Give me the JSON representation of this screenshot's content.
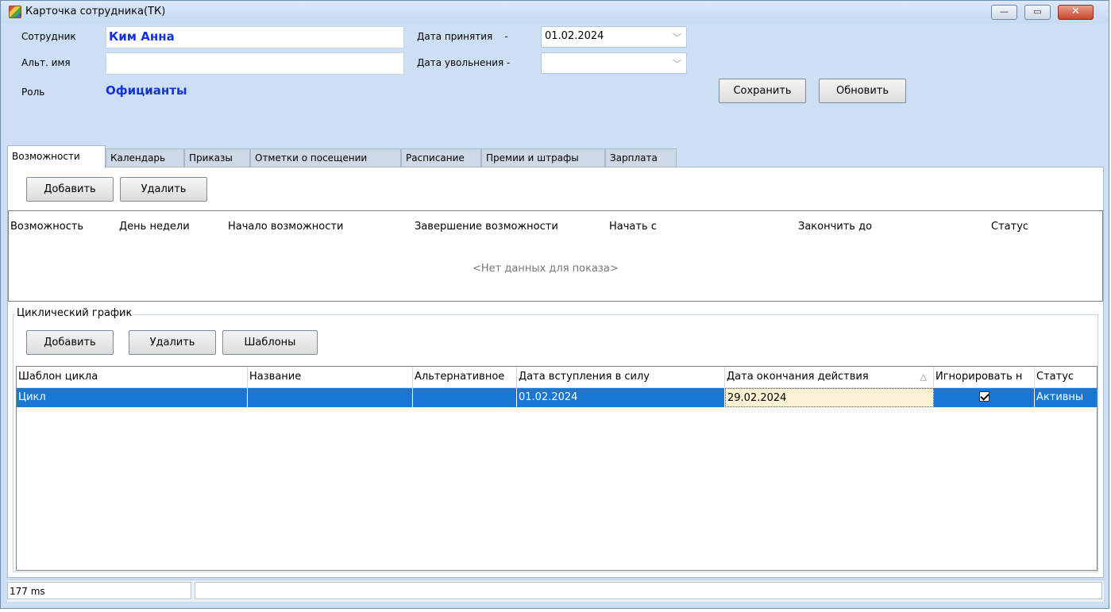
{
  "window": {
    "title": "Карточка сотрудника(ТК)",
    "min_label": "—",
    "max_label": "▭",
    "close_label": "✕"
  },
  "employee": {
    "employee_label": "Сотрудник",
    "employee_value": "Ким Анна",
    "alt_name_label": "Альт. имя",
    "alt_name_value": "",
    "role_label": "Роль",
    "role_value": "Официанты",
    "hire_date_label": "Дата принятия    -",
    "hire_date_value": "01.02.2024",
    "fire_date_label": "Дата увольнения -",
    "fire_date_value": "",
    "save_label": "Сохранить",
    "refresh_label": "Обновить"
  },
  "tabs": [
    {
      "label": "Возможности"
    },
    {
      "label": "Календарь"
    },
    {
      "label": "Приказы"
    },
    {
      "label": "Отметки о посещении"
    },
    {
      "label": "Расписание"
    },
    {
      "label": "Премии и штрафы"
    },
    {
      "label": "Зарплата"
    }
  ],
  "capabilities": {
    "add_label": "Добавить",
    "delete_label": "Удалить",
    "columns": [
      "Возможность",
      "День недели",
      "Начало возможности",
      "Завершение возможности",
      "Начать с",
      "Закончить до",
      "Статус"
    ],
    "empty_text": "<Нет данных для показа>"
  },
  "cyclic": {
    "group_label": "Циклический график",
    "add_label": "Добавить",
    "delete_label": "Удалить",
    "templates_label": "Шаблоны",
    "columns": [
      "Шаблон цикла",
      "Название",
      "Альтернативное",
      "Дата вступления в силу",
      "Дата окончания действия",
      "Игнорировать н",
      "Статус"
    ],
    "sort_indicator": "△",
    "rows": [
      {
        "template": "Цикл",
        "name": "",
        "alt": "",
        "start": "01.02.2024",
        "end": "29.02.2024",
        "ignore": true,
        "status": "Активны"
      }
    ]
  },
  "statusbar": {
    "timing": "177 ms",
    "message": ""
  },
  "colors": {
    "accent": "#1533d8",
    "selection": "#1976d2",
    "frame": "#cddff5"
  }
}
